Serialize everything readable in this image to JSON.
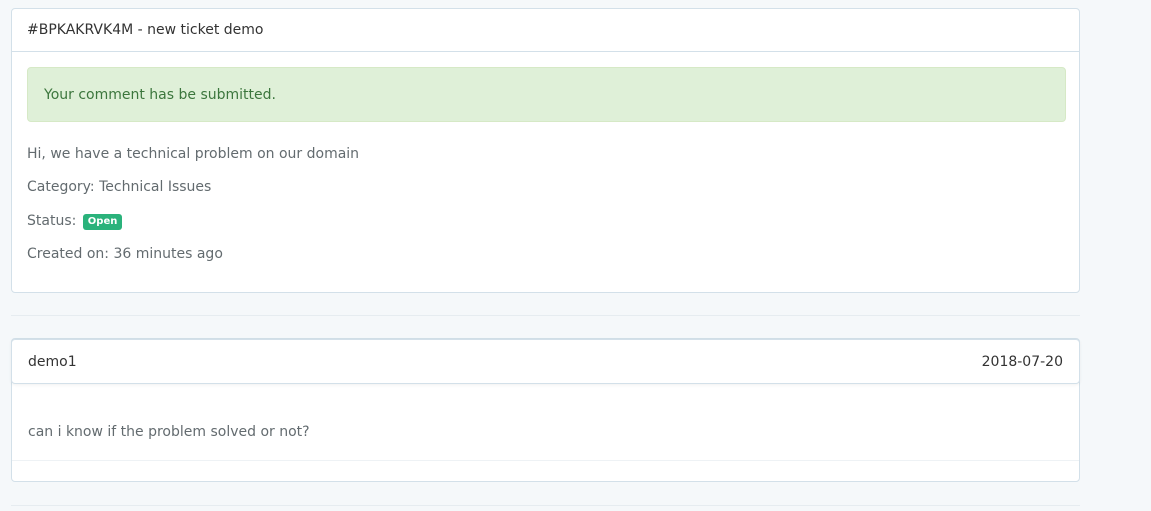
{
  "ticket": {
    "title": "#BPKAKRVK4M - new ticket demo",
    "alert": "Your comment has be submitted.",
    "message": "Hi, we have a technical problem on our domain",
    "category_label": "Category:",
    "category_value": "Technical Issues",
    "status_label": "Status:",
    "status_value": "Open",
    "created_label": "Created on:",
    "created_value": "36 minutes ago"
  },
  "comments": [
    {
      "author": "demo1",
      "date": "2018-07-20",
      "body": "can i know if the problem solved or not?"
    }
  ],
  "colors": {
    "status_open": "#2ab27b",
    "alert_bg": "#dff0d8",
    "alert_text": "#3c763d"
  }
}
